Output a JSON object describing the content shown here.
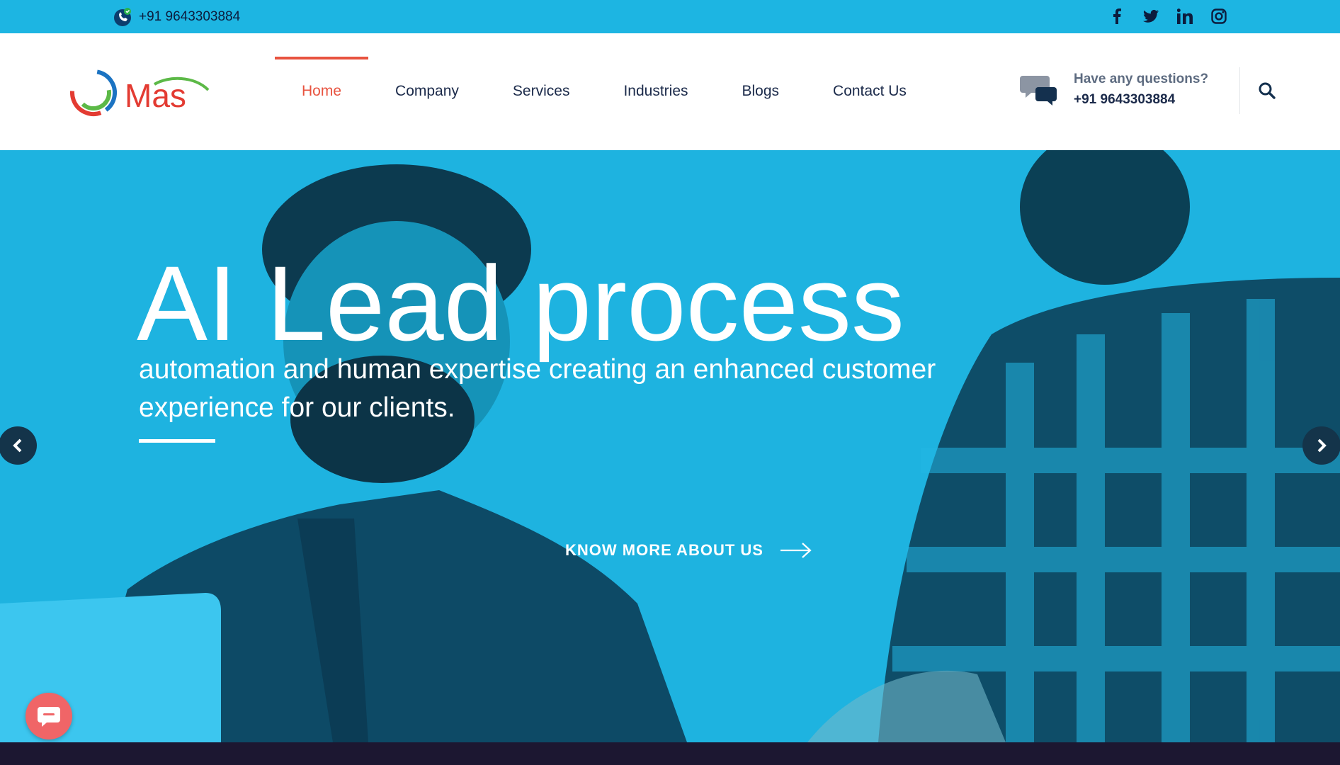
{
  "topbar": {
    "phone": "+91 9643303884",
    "phone_icon": "phone-icon",
    "social_icons": [
      "facebook-icon",
      "twitter-icon",
      "linkedin-icon",
      "instagram-icon"
    ],
    "background_color": "#1db5e2"
  },
  "header": {
    "logo_text": "Mas",
    "nav": [
      {
        "label": "Home",
        "active": true
      },
      {
        "label": "Company",
        "active": false
      },
      {
        "label": "Services",
        "active": false
      },
      {
        "label": "Industries",
        "active": false
      },
      {
        "label": "Blogs",
        "active": false
      },
      {
        "label": "Contact Us",
        "active": false
      }
    ],
    "contact": {
      "question": "Have any questions?",
      "phone": "+91 9643303884"
    },
    "accent_color": "#e8533f"
  },
  "hero": {
    "title": "AI Lead process",
    "subtitle": "automation and human expertise creating an enhanced customer experience for our clients.",
    "cta_label": "KNOW MORE ABOUT US",
    "overlay_color": "#1eb3e0"
  }
}
